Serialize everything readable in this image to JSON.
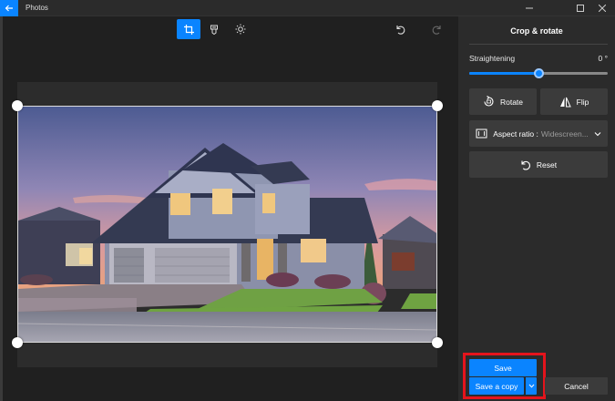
{
  "app": {
    "title": "Photos"
  },
  "toolbar": {
    "tools": [
      "crop-icon",
      "filters-icon",
      "adjust-brightness-icon"
    ],
    "undo_icon": "undo-icon",
    "redo_icon": "redo-icon"
  },
  "panel": {
    "title": "Crop & rotate",
    "straightening_label": "Straightening",
    "straightening_value": "0 °",
    "straightening_fraction": 0.5,
    "rotate_label": "Rotate",
    "flip_label": "Flip",
    "aspect_label": "Aspect ratio : ",
    "aspect_value": "Widescreen...",
    "reset_label": "Reset"
  },
  "actions": {
    "save_label": "Save",
    "save_copy_label": "Save a copy",
    "cancel_label": "Cancel"
  },
  "colors": {
    "accent": "#0a84ff",
    "highlight": "#e4141c",
    "panel_bg": "#2b2b2b"
  }
}
